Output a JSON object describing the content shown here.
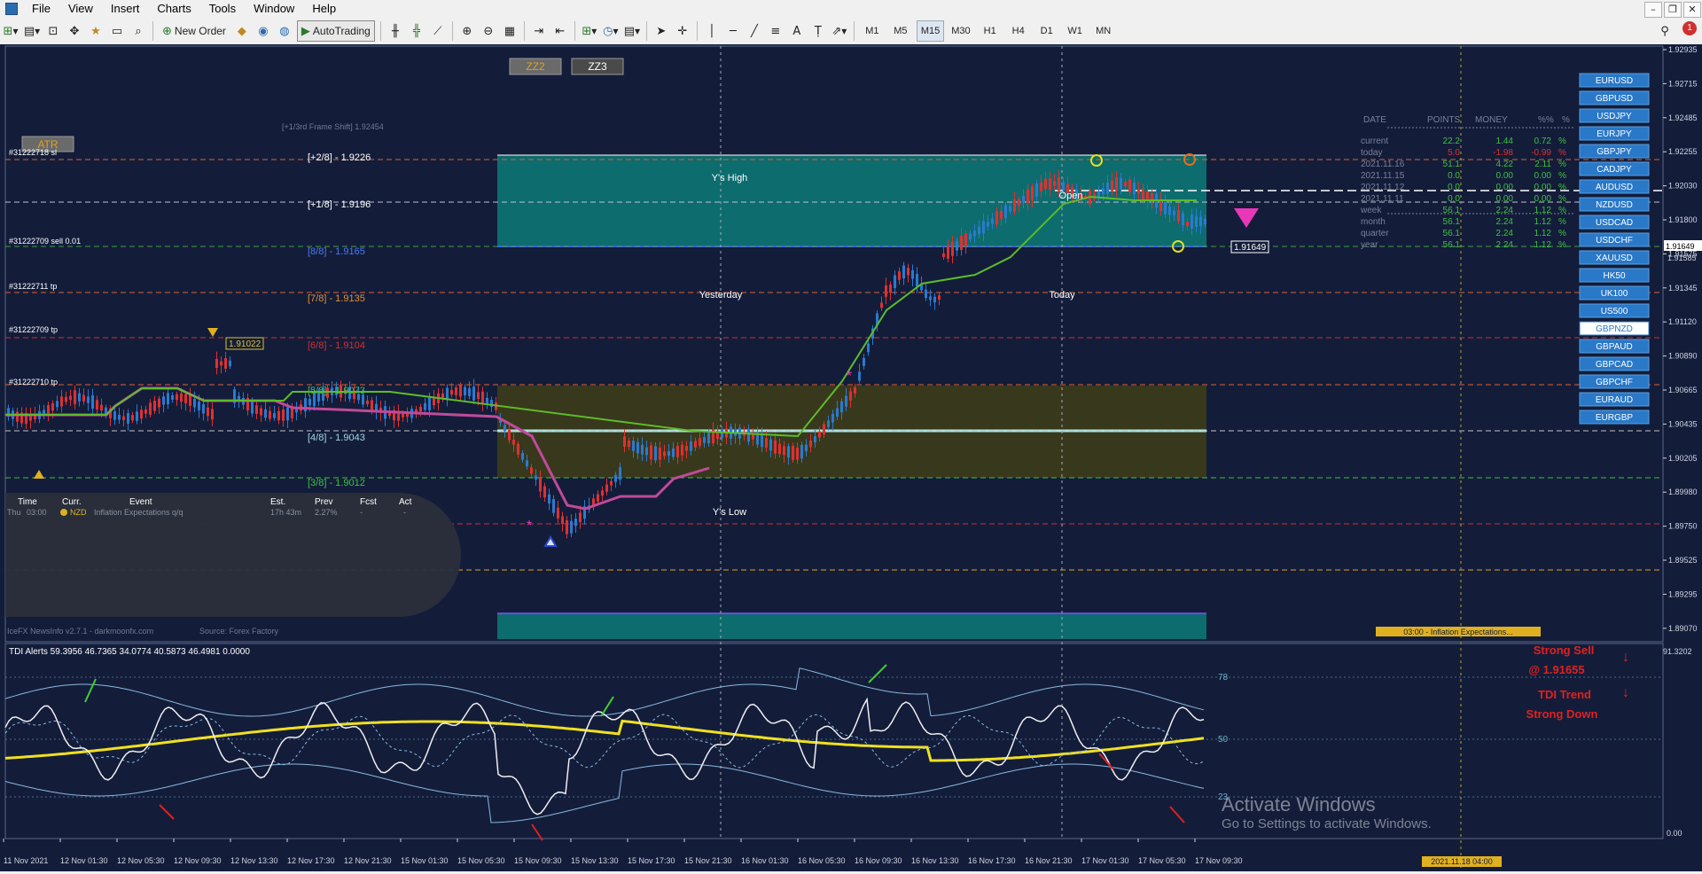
{
  "menu": {
    "items": [
      "File",
      "View",
      "Insert",
      "Charts",
      "Tools",
      "Window",
      "Help"
    ]
  },
  "toolbar": {
    "new_order": "New Order",
    "autotrading": "AutoTrading",
    "timeframes": [
      "M1",
      "M5",
      "M15",
      "M30",
      "H1",
      "H4",
      "D1",
      "W1",
      "MN"
    ],
    "selected_timeframe": "M15"
  },
  "buttons": {
    "zz2": "ZZ2",
    "zz3": "ZZ3",
    "atr": "ATR"
  },
  "frame_shift": "[+1/3rd Frame Shift]  1.92454",
  "murrey_levels": [
    "[+2/8] - 1.9226",
    "[+1/8] - 1.9196",
    "[8/8] - 1.9165",
    "[7/8] - 1.9135",
    "[6/8] - 1.9104",
    "[5/8] - 1.9073",
    "[4/8] - 1.9043",
    "[3/8] - 1.9012"
  ],
  "trade_labels": {
    "t1": "#31222718 sl",
    "t2": "#31222709 sell 0.01",
    "t3": "#31222711 tp",
    "t4": "#31222709 tp",
    "t5": "#31222710 tp"
  },
  "chart_labels": {
    "ys_high": "Y's High",
    "ys_low": "Y's Low",
    "yesterday": "Yesterday",
    "today": "Today",
    "open": "Open",
    "price_tag_left": "1.91022",
    "price_tag_right": "1.91649"
  },
  "news": {
    "headers": [
      "Time",
      "Curr.",
      "Event",
      "Est.",
      "Prev",
      "Fcst",
      "Act"
    ],
    "row": {
      "day": "Thu",
      "time": "03:00",
      "curr": "NZD",
      "event": "Inflation Expectations q/q",
      "est": "17h 43m",
      "prev": "2.27%",
      "fcst": "-",
      "act": "-"
    },
    "footer_left": "IceFX NewsInfo v2.7.1  -  darkmoonfx.com",
    "footer_right": "Source: Forex Factory"
  },
  "stats": {
    "headers": [
      "DATE",
      "POINTS",
      "MONEY",
      "%%",
      "%"
    ],
    "rows": [
      {
        "date": "current",
        "points": "22.2",
        "money": "1.44",
        "pct": "0.72",
        "sign": "%"
      },
      {
        "date": "today",
        "points": "5.0",
        "money": "-1.98",
        "pct": "-0.99",
        "sign": "%"
      },
      {
        "date": "2021.11.16",
        "points": "51.1",
        "money": "4.22",
        "pct": "2.11",
        "sign": "%"
      },
      {
        "date": "2021.11.15",
        "points": "0.0",
        "money": "0.00",
        "pct": "0.00",
        "sign": "%"
      },
      {
        "date": "2021.11.12",
        "points": "0.0",
        "money": "0.00",
        "pct": "0.00",
        "sign": "%"
      },
      {
        "date": "2021.11.11",
        "points": "0.0",
        "money": "0.00",
        "pct": "0.00",
        "sign": "%"
      },
      {
        "date": "week",
        "points": "56.1",
        "money": "2.24",
        "pct": "1.12",
        "sign": "%"
      },
      {
        "date": "month",
        "points": "56.1",
        "money": "2.24",
        "pct": "1.12",
        "sign": "%"
      },
      {
        "date": "quarter",
        "points": "56.1",
        "money": "2.24",
        "pct": "1.12",
        "sign": "%"
      },
      {
        "date": "year",
        "points": "56.1",
        "money": "2.24",
        "pct": "1.12",
        "sign": "%"
      }
    ]
  },
  "symbols": [
    "EURUSD",
    "GBPUSD",
    "USDJPY",
    "EURJPY",
    "GBPJPY",
    "CADJPY",
    "AUDUSD",
    "NZDUSD",
    "USDCAD",
    "USDCHF",
    "XAUUSD",
    "HK50",
    "UK100",
    "US500",
    "GBPNZD",
    "GBPAUD",
    "GBPCAD",
    "GBPCHF",
    "EURAUD",
    "EURGBP"
  ],
  "active_symbol": "GBPNZD",
  "price_axis": [
    "1.92935",
    "1.92715",
    "1.92485",
    "1.92255",
    "1.92030",
    "1.91800",
    "1.91575",
    "1.91345",
    "1.91120",
    "1.90890",
    "1.90665",
    "1.90435",
    "1.90205",
    "1.89980",
    "1.89750",
    "1.89525",
    "1.89295",
    "1.89070"
  ],
  "current_price": "1.91649",
  "price_axis_extra": "1.91585",
  "news_bar": "03:00 - Inflation Expectations...",
  "tdi": {
    "title": "TDI Alerts  59.3956 46.7365 34.0774 40.5873 46.4981 0.0000",
    "levels": [
      "78",
      "50",
      "23"
    ],
    "axis_top": "91.3202",
    "axis_bottom": "0.00",
    "signal1_a": "Strong Sell",
    "signal1_b": "@ 1.91655",
    "signal2_a": "TDI Trend",
    "signal2_b": "Strong Down"
  },
  "time_axis": [
    "11 Nov 2021",
    "12 Nov 01:30",
    "12 Nov 05:30",
    "12 Nov 09:30",
    "12 Nov 13:30",
    "12 Nov 17:30",
    "12 Nov 21:30",
    "15 Nov 01:30",
    "15 Nov 05:30",
    "15 Nov 09:30",
    "15 Nov 13:30",
    "15 Nov 17:30",
    "15 Nov 21:30",
    "16 Nov 01:30",
    "16 Nov 05:30",
    "16 Nov 09:30",
    "16 Nov 13:30",
    "16 Nov 17:30",
    "16 Nov 21:30",
    "17 Nov 01:30",
    "17 Nov 05:30",
    "17 Nov 09:30"
  ],
  "time_cursor": "2021.11.18 04:00",
  "watermark": {
    "line1": "Activate Windows",
    "line2": "Go to Settings to activate Windows."
  },
  "colors": {
    "bg": "#131d3a",
    "teal_box": "#0d7a78",
    "yellow_box": "#3a3a1a",
    "green_line": "#5dbb2a",
    "pink_line": "#c04a9a"
  }
}
